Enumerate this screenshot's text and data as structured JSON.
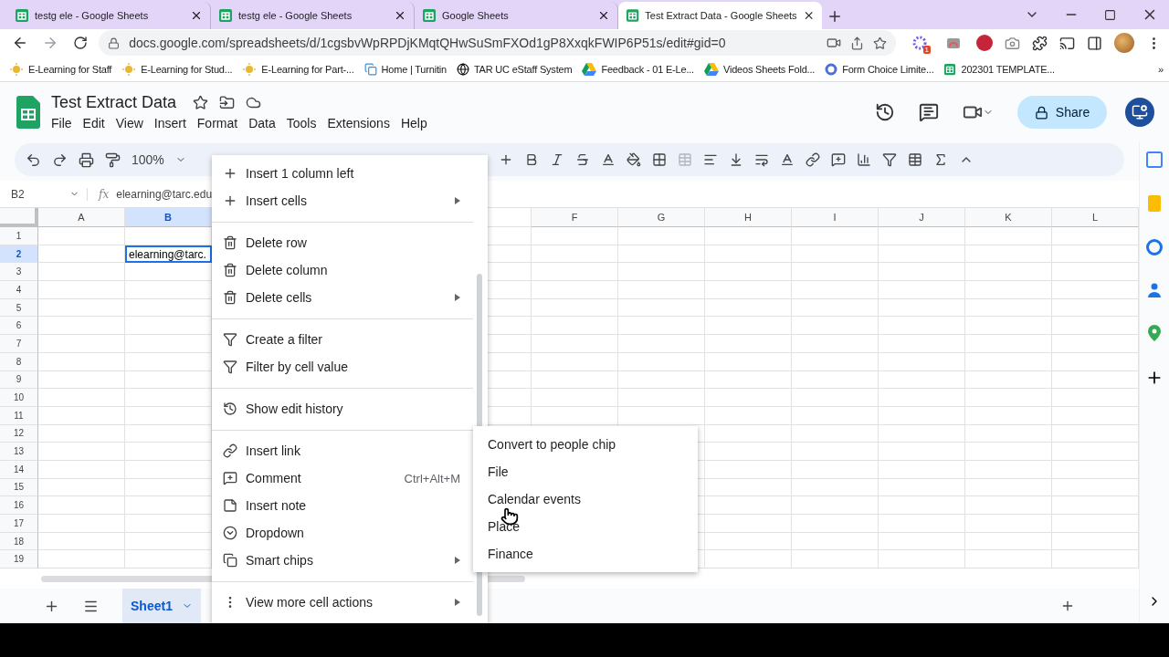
{
  "browser_tabs": [
    {
      "title": "testg ele - Google Sheets",
      "selected": false
    },
    {
      "title": "testg ele - Google Sheets",
      "selected": false
    },
    {
      "title": "Google Sheets",
      "selected": false
    },
    {
      "title": "Test Extract Data - Google Sheets",
      "selected": true
    }
  ],
  "address_bar": {
    "url": "docs.google.com/spreadsheets/d/1cgsbvWpRPDjKMqtQHwSuSmFXOd1gP8XxqkFWIP6P51s/edit#gid=0"
  },
  "extension_badge": "1",
  "bookmarks": [
    "E-Learning for Staff",
    "E-Learning for Stud...",
    "E-Learning for Part-...",
    "Home | Turnitin",
    "TAR UC eStaff System",
    "Feedback - 01 E-Le...",
    "Videos Sheets Fold...",
    "Form Choice Limite...",
    "202301 TEMPLATE..."
  ],
  "bookmarks_more": "»",
  "document": {
    "title": "Test Extract Data",
    "menu": [
      "File",
      "Edit",
      "View",
      "Insert",
      "Format",
      "Data",
      "Tools",
      "Extensions",
      "Help"
    ],
    "share_label": "Share"
  },
  "toolbar": {
    "zoom": "100%"
  },
  "formula_bar": {
    "cell_ref": "B2",
    "fx": "fx",
    "content": "elearning@tarc.edu"
  },
  "grid": {
    "columns": [
      {
        "label": "A",
        "selected": false
      },
      {
        "label": "B",
        "selected": true
      },
      {
        "label": "F",
        "selected": false
      },
      {
        "label": "G",
        "selected": false
      },
      {
        "label": "H",
        "selected": false
      },
      {
        "label": "I",
        "selected": false
      },
      {
        "label": "J",
        "selected": false
      },
      {
        "label": "K",
        "selected": false
      },
      {
        "label": "L",
        "selected": false
      }
    ],
    "rows": [
      {
        "label": "1",
        "selected": false
      },
      {
        "label": "2",
        "selected": true
      },
      {
        "label": "3",
        "selected": false
      },
      {
        "label": "4",
        "selected": false
      },
      {
        "label": "5",
        "selected": false
      },
      {
        "label": "6",
        "selected": false
      },
      {
        "label": "7",
        "selected": false
      },
      {
        "label": "8",
        "selected": false
      },
      {
        "label": "9",
        "selected": false
      },
      {
        "label": "10",
        "selected": false
      },
      {
        "label": "11",
        "selected": false
      },
      {
        "label": "12",
        "selected": false
      },
      {
        "label": "13",
        "selected": false
      },
      {
        "label": "14",
        "selected": false
      },
      {
        "label": "15",
        "selected": false
      },
      {
        "label": "16",
        "selected": false
      },
      {
        "label": "17",
        "selected": false
      },
      {
        "label": "18",
        "selected": false
      },
      {
        "label": "19",
        "selected": false
      }
    ],
    "active_cell_value": "elearning@tarc."
  },
  "context_menu": [
    {
      "kind": "item",
      "label": "Insert 1 column left",
      "submenu": false
    },
    {
      "kind": "item",
      "label": "Insert cells",
      "submenu": true
    },
    {
      "kind": "divider"
    },
    {
      "kind": "item",
      "label": "Delete row",
      "submenu": false
    },
    {
      "kind": "item",
      "label": "Delete column",
      "submenu": false
    },
    {
      "kind": "item",
      "label": "Delete cells",
      "submenu": true
    },
    {
      "kind": "divider"
    },
    {
      "kind": "item",
      "label": "Create a filter",
      "submenu": false
    },
    {
      "kind": "item",
      "label": "Filter by cell value",
      "submenu": false
    },
    {
      "kind": "divider"
    },
    {
      "kind": "item",
      "label": "Show edit history",
      "submenu": false
    },
    {
      "kind": "divider"
    },
    {
      "kind": "item",
      "label": "Insert link",
      "submenu": false
    },
    {
      "kind": "item",
      "label": "Comment",
      "shortcut": "Ctrl+Alt+M",
      "submenu": false
    },
    {
      "kind": "item",
      "label": "Insert note",
      "submenu": false
    },
    {
      "kind": "item",
      "label": "Dropdown",
      "submenu": false
    },
    {
      "kind": "item",
      "label": "Smart chips",
      "submenu": true
    },
    {
      "kind": "divider"
    },
    {
      "kind": "item",
      "label": "View more cell actions",
      "submenu": true
    }
  ],
  "smart_chips_menu": [
    "Convert to people chip",
    "File",
    "Calendar events",
    "Place",
    "Finance"
  ],
  "sheet_tabs": [
    {
      "label": "Sheet1",
      "selected": true
    }
  ]
}
